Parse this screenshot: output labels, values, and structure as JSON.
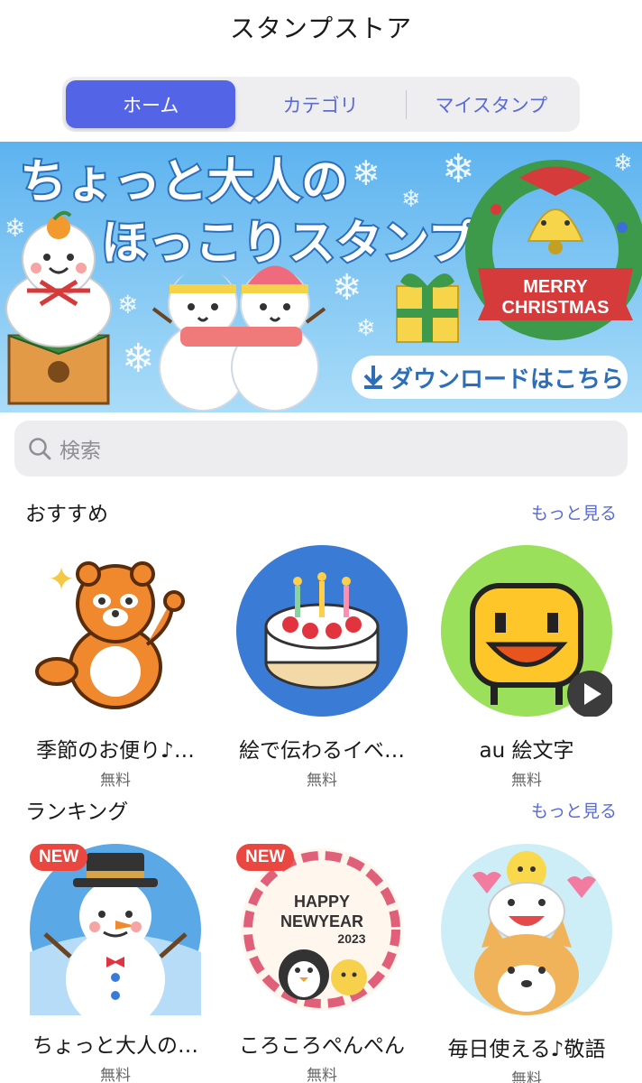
{
  "header": {
    "title": "スタンプストア"
  },
  "tabs": [
    {
      "label": "ホーム",
      "active": true
    },
    {
      "label": "カテゴリ",
      "active": false
    },
    {
      "label": "マイスタンプ",
      "active": false
    }
  ],
  "banner": {
    "headline_line1": "ちょっと大人の",
    "headline_line2": "ほっこりスタンプ",
    "wreath_text_line1": "MERRY",
    "wreath_text_line2": "CHRISTMAS",
    "download_label": "ダウンロードはこちら"
  },
  "search": {
    "placeholder": "検索"
  },
  "recommended": {
    "title": "おすすめ",
    "more": "もっと見る",
    "items": [
      {
        "name": "季節のお便り♪…",
        "price": "無料"
      },
      {
        "name": "絵で伝わるイベ…",
        "price": "無料"
      },
      {
        "name": "au 絵文字",
        "price": "無料"
      }
    ]
  },
  "ranking": {
    "title": "ランキング",
    "more": "もっと見る",
    "items": [
      {
        "name": "ちょっと大人の…",
        "price": "無料",
        "badge": "NEW"
      },
      {
        "name": "ころころぺんぺん",
        "price": "無料",
        "badge": "NEW",
        "art_line1": "HAPPY",
        "art_line2": "NEWYEAR",
        "art_line3": "2023"
      },
      {
        "name": "毎日使える♪敬語",
        "price": "無料"
      }
    ]
  },
  "colors": {
    "accent": "#5464e6",
    "link": "#5a6ad6",
    "badge": "#e9473f"
  }
}
